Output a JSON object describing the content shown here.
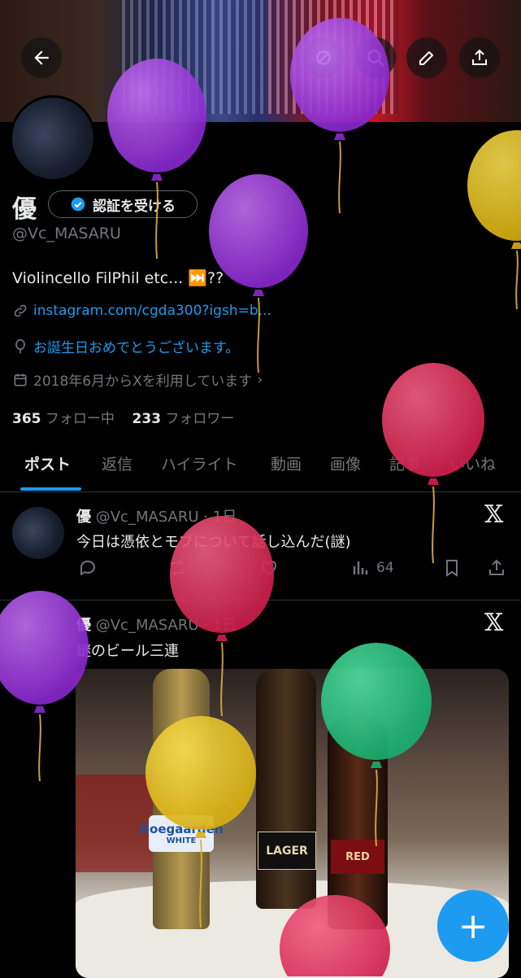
{
  "header": {
    "back_icon": "arrow-left-icon",
    "edit_icon": "pencil-icon",
    "share_icon": "share-icon"
  },
  "profile": {
    "name": "優",
    "verify_button": "認証を受ける",
    "handle": "@Vc_MASARU",
    "bio": "Violincello FilPhil etc... ⏭️??",
    "link": "instagram.com/cgda300?igsh=b...",
    "birthday": "お誕生日おめでとうございます。",
    "joined": "2018年6月からXを利用しています",
    "following_count": "365",
    "following_label": "フォロー中",
    "followers_count": "233",
    "followers_label": "フォロワー"
  },
  "tabs": [
    "ポスト",
    "返信",
    "ハイライト",
    "動画",
    "画像",
    "記事",
    "いいね"
  ],
  "posts": [
    {
      "name": "優",
      "handle": "@Vc_MASARU",
      "time": "1日",
      "text": "今日は憑依とモブについて話し込んだ(謎)",
      "views": "64"
    },
    {
      "name": "優",
      "handle": "@Vc_MASARU",
      "time": "1日",
      "text": "謎のビール三連",
      "image_labels": [
        "Hoegaarden",
        "WHITE",
        "LAGER",
        "RED"
      ]
    }
  ],
  "fab_label": "+",
  "colors": {
    "accent": "#1d9bf0",
    "background": "#000000",
    "text": "#e7e9ea",
    "muted": "#71767b"
  }
}
